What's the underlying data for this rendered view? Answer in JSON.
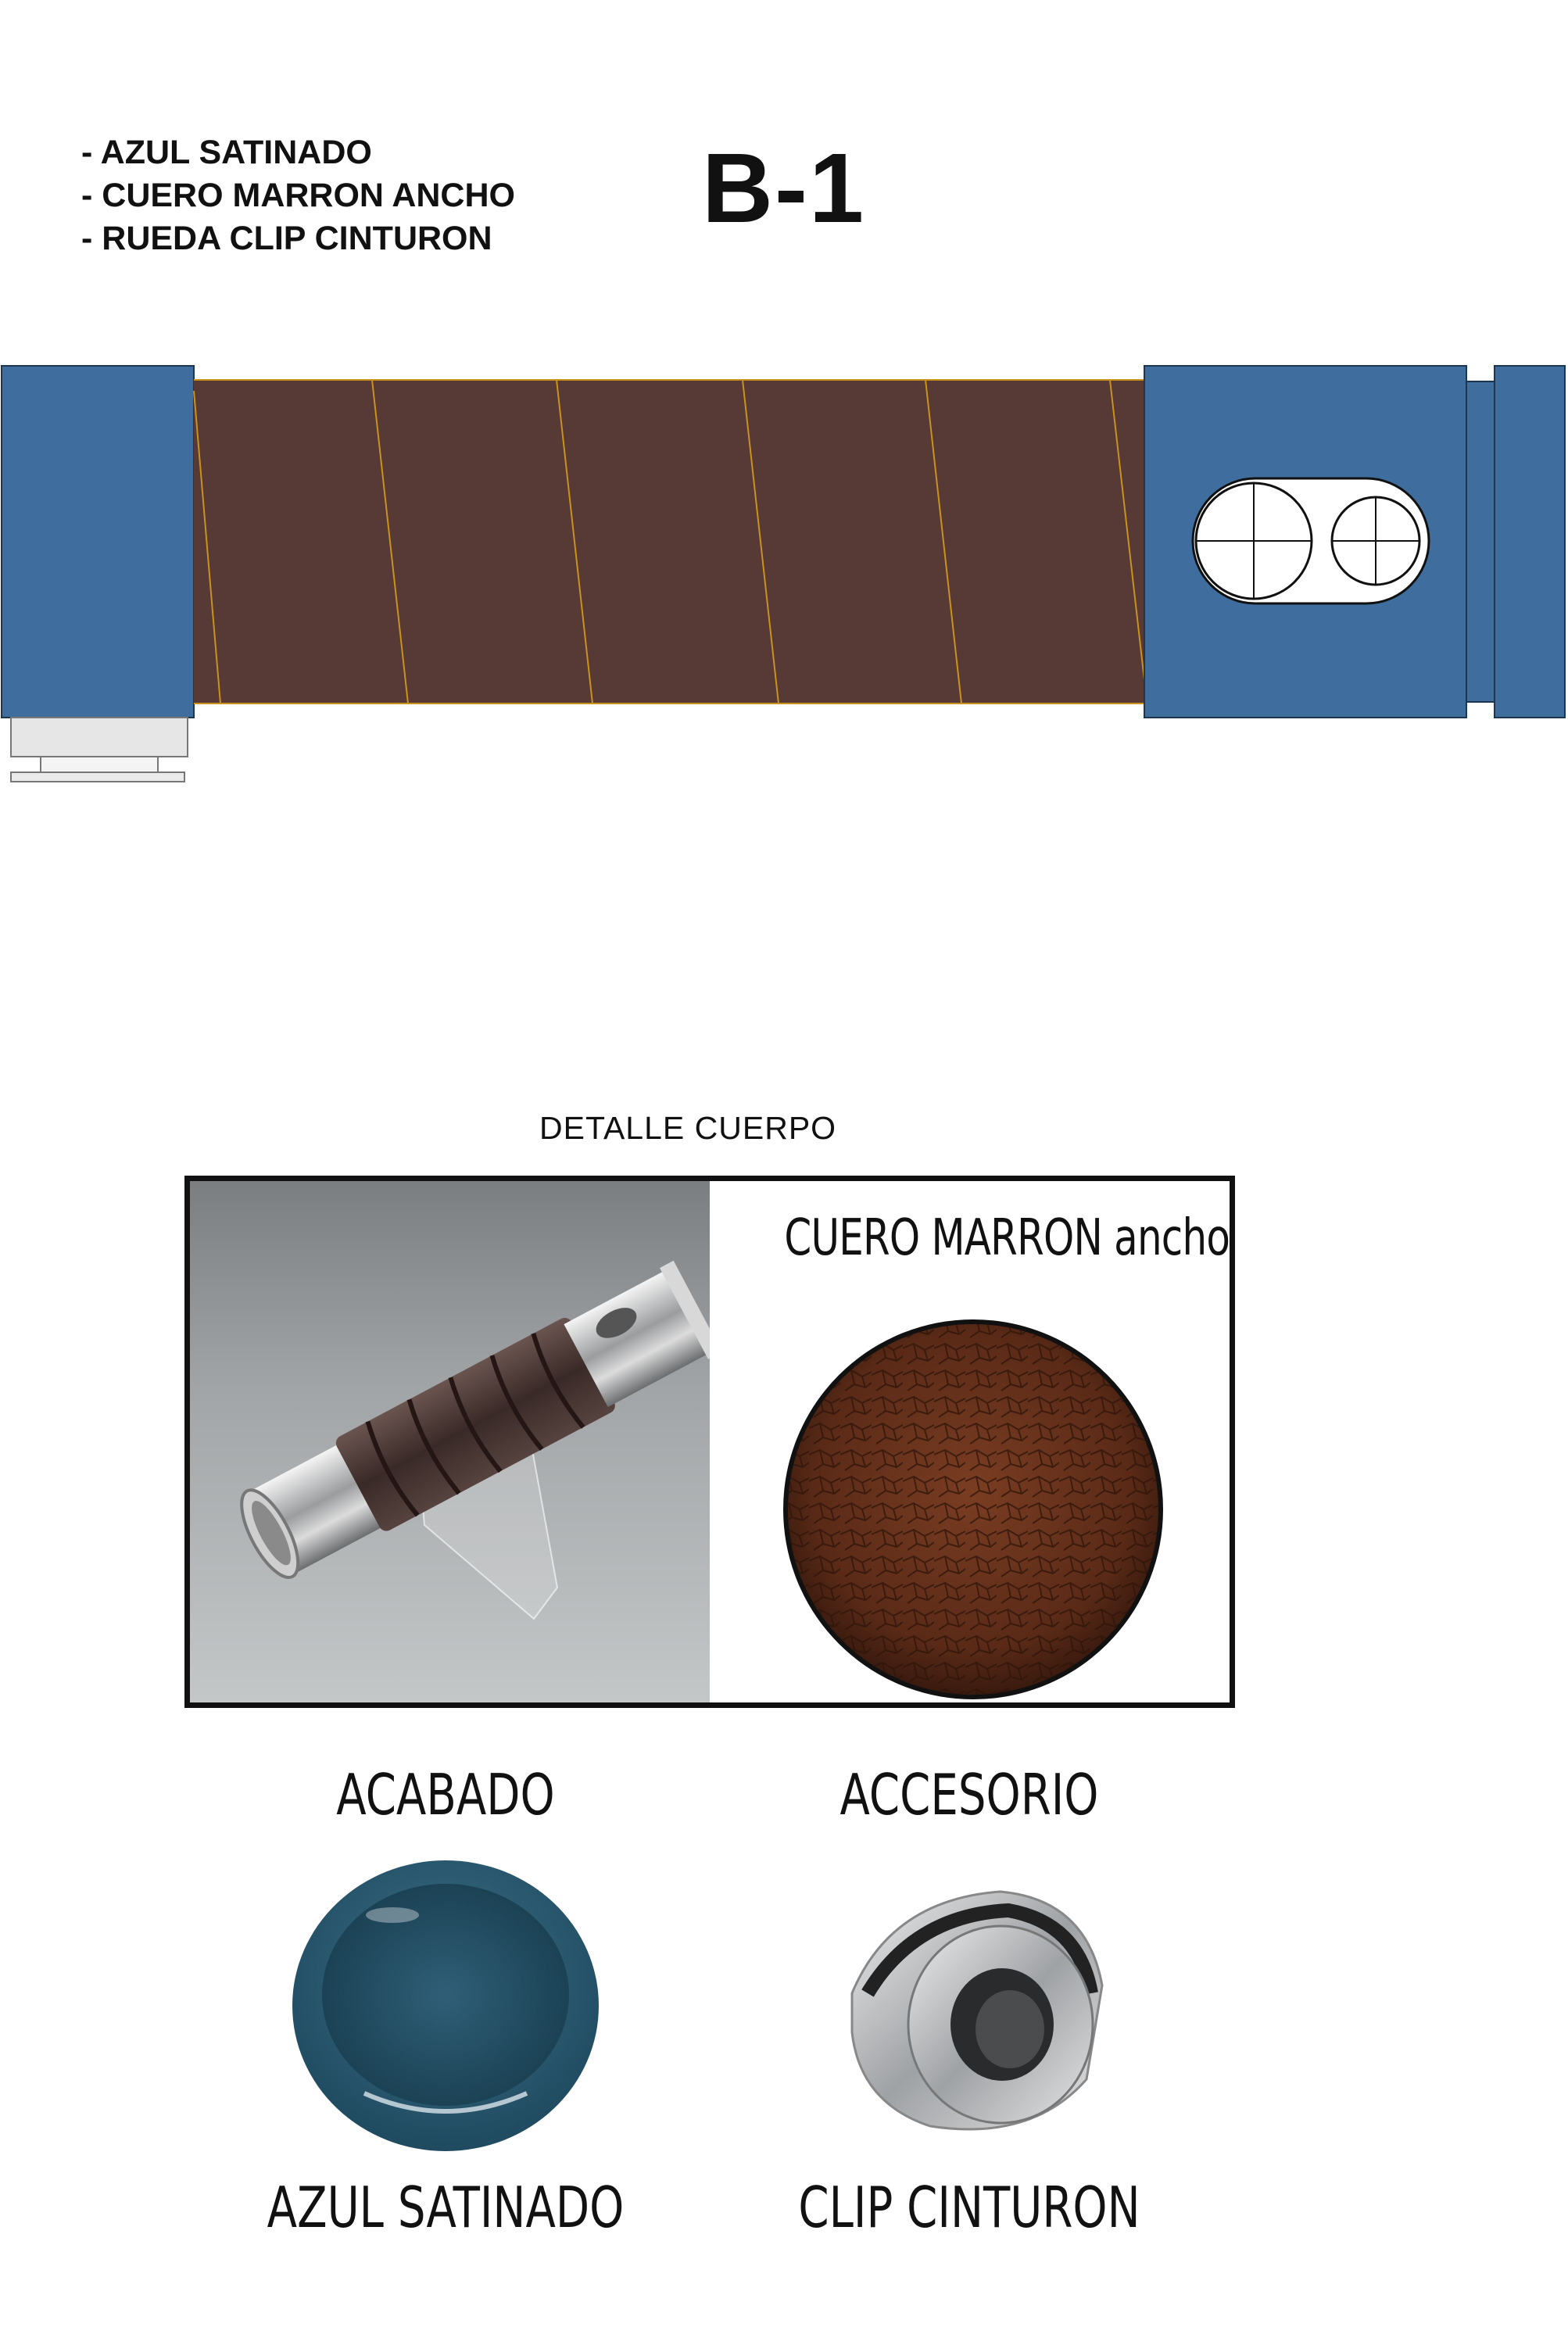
{
  "specs": {
    "items": [
      "- AZUL SATINADO",
      "- CUERO MARRON ANCHO",
      "- RUEDA CLIP CINTURON"
    ]
  },
  "model": {
    "code": "B-1"
  },
  "drawing": {
    "colors": {
      "metal_blue": "#3e6d9e",
      "leather_brown": "#573936",
      "stitch": "#c8921c",
      "clip_grey": "#e6e6e6"
    }
  },
  "detail": {
    "title": "DETALLE CUERPO",
    "leather_name": "CUERO MARRON ancho"
  },
  "finish": {
    "heading": "ACABADO",
    "name": "AZUL SATINADO",
    "color": "#2f5f77"
  },
  "accessory": {
    "heading": "ACCESORIO",
    "name": "CLIP CINTURON"
  }
}
